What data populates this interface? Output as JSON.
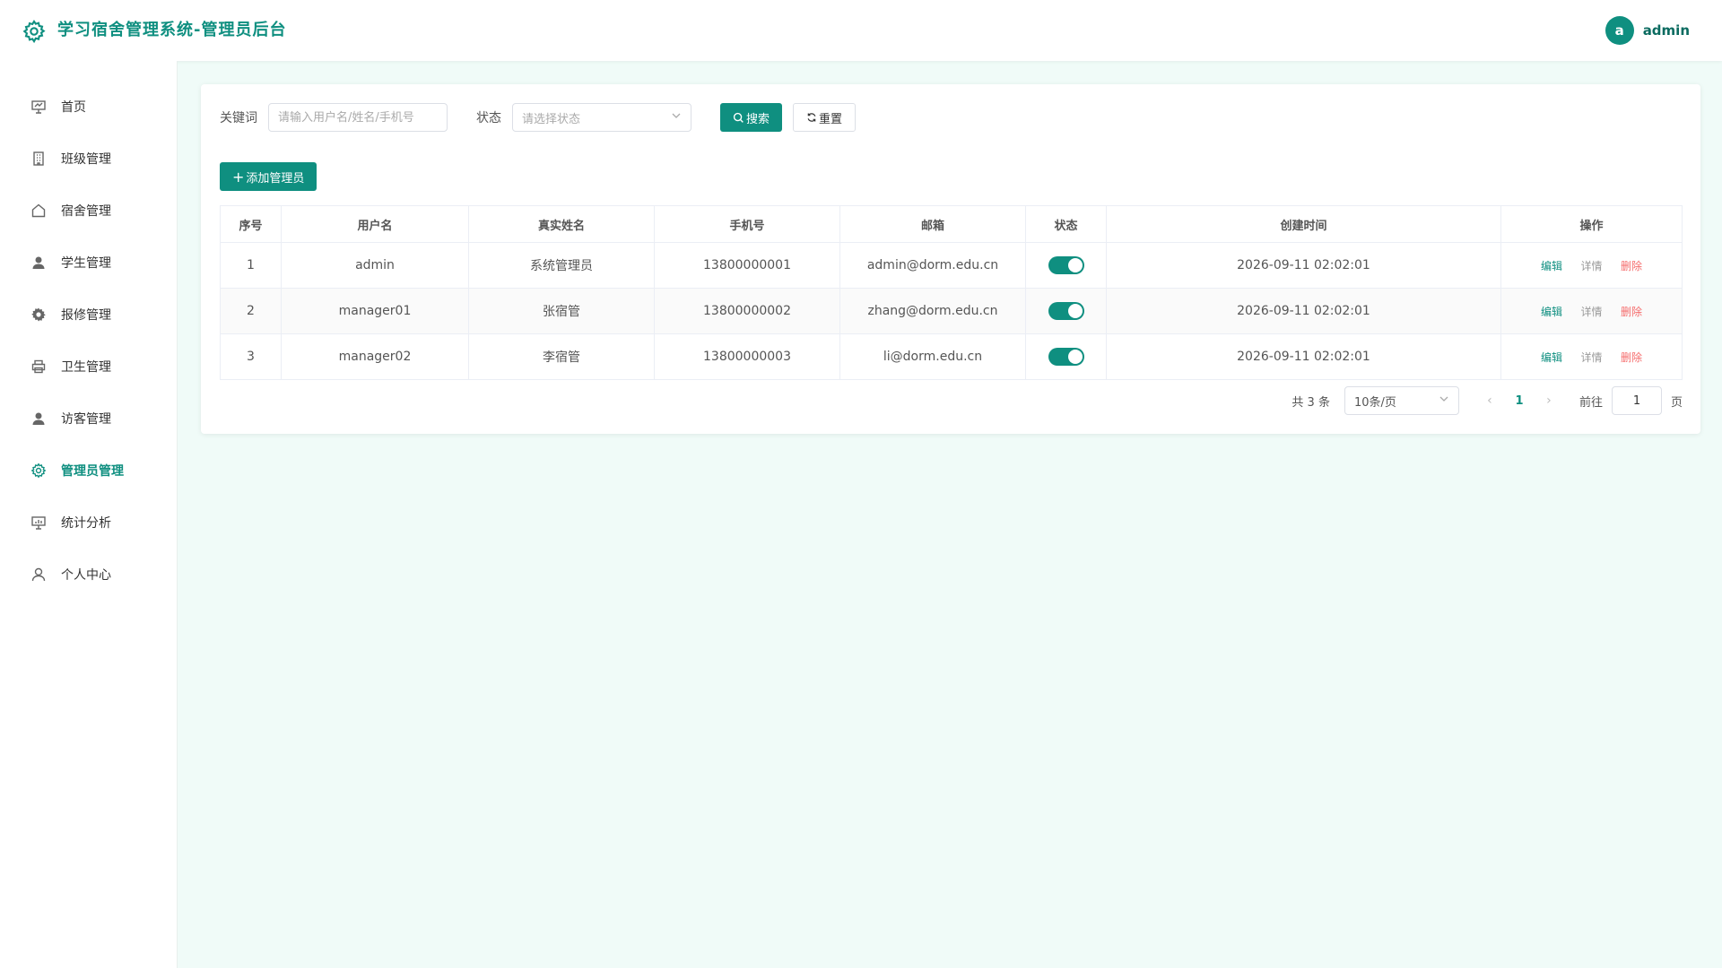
{
  "header": {
    "title": "学习宿舍管理系统-管理员后台",
    "avatar_letter": "a",
    "username": "admin"
  },
  "sidebar": {
    "items": [
      {
        "label": "首页",
        "icon": "dashboard-icon"
      },
      {
        "label": "班级管理",
        "icon": "building-icon"
      },
      {
        "label": "宿舍管理",
        "icon": "house-icon"
      },
      {
        "label": "学生管理",
        "icon": "user-icon"
      },
      {
        "label": "报修管理",
        "icon": "gear-icon"
      },
      {
        "label": "卫生管理",
        "icon": "printer-icon"
      },
      {
        "label": "访客管理",
        "icon": "user-icon"
      },
      {
        "label": "管理员管理",
        "icon": "settings-icon",
        "active": true
      },
      {
        "label": "统计分析",
        "icon": "chart-icon"
      },
      {
        "label": "个人中心",
        "icon": "person-icon"
      }
    ]
  },
  "filter": {
    "keyword_label": "关键词",
    "keyword_placeholder": "请输入用户名/姓名/手机号",
    "status_label": "状态",
    "status_placeholder": "请选择状态",
    "search_label": "搜索",
    "reset_label": "重置"
  },
  "add_button_label": "添加管理员",
  "table": {
    "columns": [
      "序号",
      "用户名",
      "真实姓名",
      "手机号",
      "邮箱",
      "状态",
      "创建时间",
      "操作"
    ],
    "rows": [
      {
        "index": "1",
        "username": "admin",
        "realname": "系统管理员",
        "phone": "13800000001",
        "email": "admin@dorm.edu.cn",
        "status": true,
        "created": "2026-09-11 02:02:01"
      },
      {
        "index": "2",
        "username": "manager01",
        "realname": "张宿管",
        "phone": "13800000002",
        "email": "zhang@dorm.edu.cn",
        "status": true,
        "created": "2026-09-11 02:02:01"
      },
      {
        "index": "3",
        "username": "manager02",
        "realname": "李宿管",
        "phone": "13800000003",
        "email": "li@dorm.edu.cn",
        "status": true,
        "created": "2026-09-11 02:02:01"
      }
    ],
    "actions": {
      "edit": "编辑",
      "detail": "详情",
      "delete": "删除"
    }
  },
  "pagination": {
    "total_text": "共 3 条",
    "page_size": "10条/页",
    "current_page": "1",
    "goto_label": "前往",
    "goto_value": "1",
    "page_suffix": "页"
  },
  "colors": {
    "accent": "#0f8f80",
    "danger": "#f56c6c"
  }
}
